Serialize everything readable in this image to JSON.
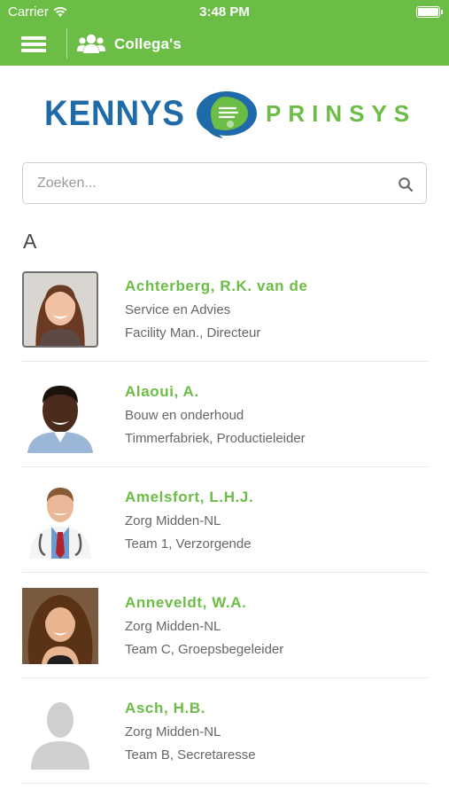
{
  "status_bar": {
    "carrier": "Carrier",
    "time": "3:48 PM"
  },
  "nav": {
    "menu_icon": "hamburger-menu-icon",
    "section_icon": "people-group-icon",
    "title": "Collega's"
  },
  "logo": {
    "left_word": "KENNYS",
    "right_word": "PRINSYS"
  },
  "search": {
    "placeholder": "Zoeken...",
    "value": "",
    "icon": "search-icon"
  },
  "section_header": "A",
  "contacts": [
    {
      "name": "Achterberg, R.K. van de",
      "department": "Service en Advies",
      "role": "Facility Man., Directeur"
    },
    {
      "name": "Alaoui, A.",
      "department": "Bouw en onderhoud",
      "role": "Timmerfabriek, Productieleider"
    },
    {
      "name": "Amelsfort, L.H.J.",
      "department": "Zorg Midden-NL",
      "role": "Team 1, Verzorgende"
    },
    {
      "name": "Anneveldt, W.A.",
      "department": "Zorg Midden-NL",
      "role": "Team C, Groepsbegeleider"
    },
    {
      "name": "Asch, H.B.",
      "department": "Zorg Midden-NL",
      "role": "Team B, Secretaresse"
    }
  ],
  "colors": {
    "brand_green": "#6cbd45",
    "brand_blue": "#1f6aa8"
  }
}
